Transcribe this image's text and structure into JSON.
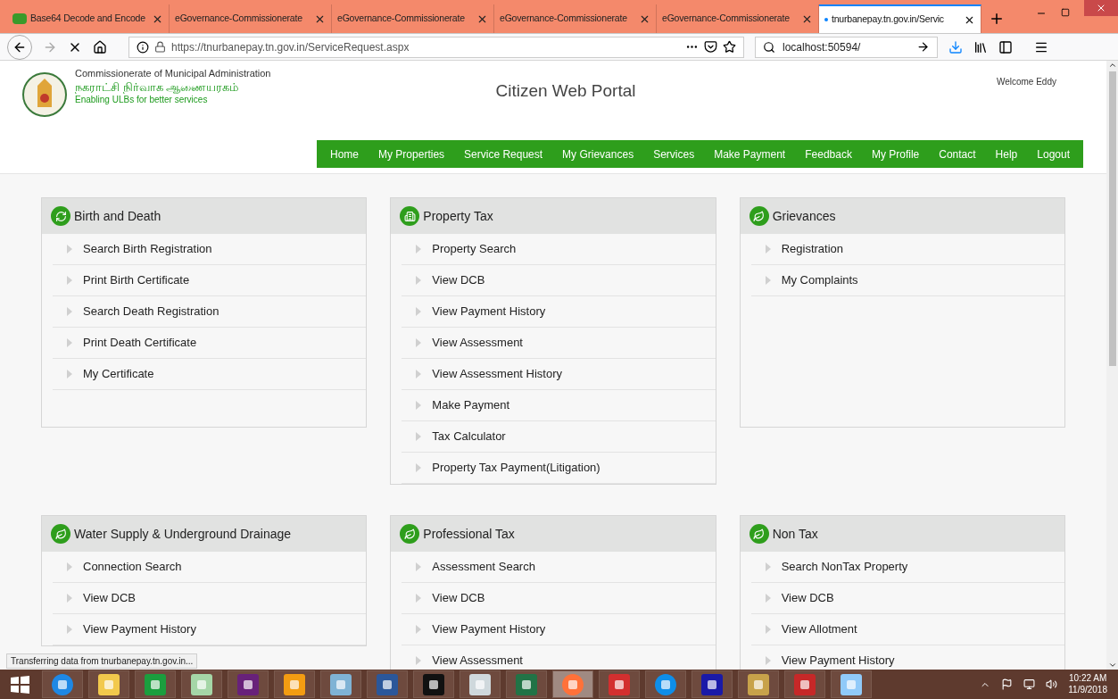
{
  "browser": {
    "tabs": [
      {
        "label": "Base64 Decode and Encode",
        "selected": false,
        "kind": "b64"
      },
      {
        "label": "eGovernance-Commissionerate",
        "selected": false,
        "kind": "page"
      },
      {
        "label": "eGovernance-Commissionerate",
        "selected": false,
        "kind": "page"
      },
      {
        "label": "eGovernance-Commissionerate",
        "selected": false,
        "kind": "page"
      },
      {
        "label": "eGovernance-Commissionerate",
        "selected": false,
        "kind": "page"
      },
      {
        "label": "tnurbanepay.tn.gov.in/Servic",
        "selected": true,
        "kind": "loading"
      }
    ],
    "url": "https://tnurbanepay.tn.gov.in/ServiceRequest.aspx",
    "search": "localhost:50594/",
    "status": "Transferring data from tnurbanepay.tn.gov.in..."
  },
  "header": {
    "org": "Commissionerate of Municipal Administration",
    "org_tamil": "நகராட்சி நிர்வாக ஆணையரகம்",
    "tagline": "Enabling ULBs for better services",
    "title": "Citizen Web Portal",
    "welcome": "Welcome Eddy"
  },
  "menu": [
    "Home",
    "My Properties",
    "Service Request",
    "My Grievances",
    "Services",
    "Make Payment",
    "Feedback",
    "My Profile",
    "Contact",
    "Help",
    "Logout"
  ],
  "panels": [
    {
      "title": "Birth and Death",
      "kind": "recycle",
      "items": [
        "Search Birth Registration",
        "Print Birth Certificate",
        "Search Death Registration",
        "Print Death Certificate",
        "My Certificate"
      ]
    },
    {
      "title": "Property Tax",
      "kind": "building",
      "items": [
        "Property Search",
        "View DCB",
        "View Payment History",
        "View Assessment",
        "View Assessment History",
        "Make Payment",
        "Tax Calculator",
        "Property Tax Payment(Litigation)"
      ]
    },
    {
      "title": "Grievances",
      "kind": "leaf",
      "items": [
        "Registration",
        "My Complaints"
      ]
    },
    {
      "title": "Water Supply & Underground Drainage",
      "kind": "leaf",
      "items": [
        "Connection Search",
        "View DCB",
        "View Payment History"
      ]
    },
    {
      "title": "Professional Tax",
      "kind": "leaf",
      "items": [
        "Assessment Search",
        "View DCB",
        "View Payment History",
        "View Assessment"
      ]
    },
    {
      "title": "Non Tax",
      "kind": "leaf",
      "items": [
        "Search NonTax Property",
        "View DCB",
        "View Allotment",
        "View Payment History"
      ]
    }
  ],
  "taskbar": {
    "apps": [
      {
        "kind": "ie",
        "selected": false
      },
      {
        "kind": "folder",
        "selected": false
      },
      {
        "kind": "store",
        "selected": false
      },
      {
        "kind": "notes",
        "selected": false
      },
      {
        "kind": "vs",
        "selected": false
      },
      {
        "kind": "outlook",
        "selected": false
      },
      {
        "kind": "notepad",
        "selected": false
      },
      {
        "kind": "word",
        "selected": false
      },
      {
        "kind": "cmd",
        "selected": false
      },
      {
        "kind": "taskmgr",
        "selected": false
      },
      {
        "kind": "excel",
        "selected": false
      },
      {
        "kind": "firefox",
        "selected": true
      },
      {
        "kind": "xampp",
        "selected": false
      },
      {
        "kind": "teamviewer",
        "selected": false
      },
      {
        "kind": "doc",
        "selected": false
      },
      {
        "kind": "tools",
        "selected": false
      },
      {
        "kind": "pdf",
        "selected": false
      },
      {
        "kind": "paint",
        "selected": false
      }
    ],
    "time": "10:22 AM",
    "date": "11/9/2018"
  }
}
